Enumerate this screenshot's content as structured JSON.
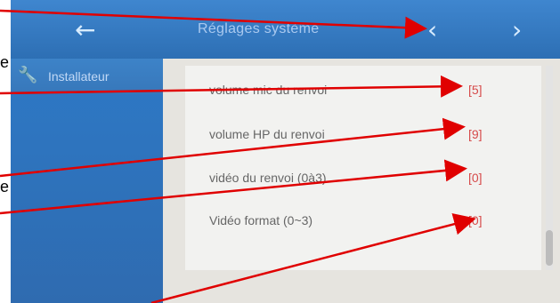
{
  "header": {
    "title": "Réglages système",
    "back_icon": "back-arrow-icon",
    "prev_icon": "chevron-left-icon",
    "next_icon": "chevron-right-icon"
  },
  "sidebar": {
    "items": [
      {
        "label": "Installateur",
        "icon": "wrench-icon"
      }
    ]
  },
  "settings": [
    {
      "label": "volume mic du renvoi",
      "value": "[5]"
    },
    {
      "label": "volume HP du renvoi",
      "value": "[9]"
    },
    {
      "label": "vidéo du renvoi (0à3)",
      "value": "[0]"
    },
    {
      "label": "Vidéo format (0~3)",
      "value": "[0]"
    }
  ],
  "annotations": [
    {
      "text": "e"
    },
    {
      "text": "e"
    }
  ],
  "colors": {
    "header_blue": "#3f86cf",
    "sidebar_blue": "#2f6bb0",
    "value_red": "#d64a4a",
    "arrow_red": "#e00000"
  }
}
